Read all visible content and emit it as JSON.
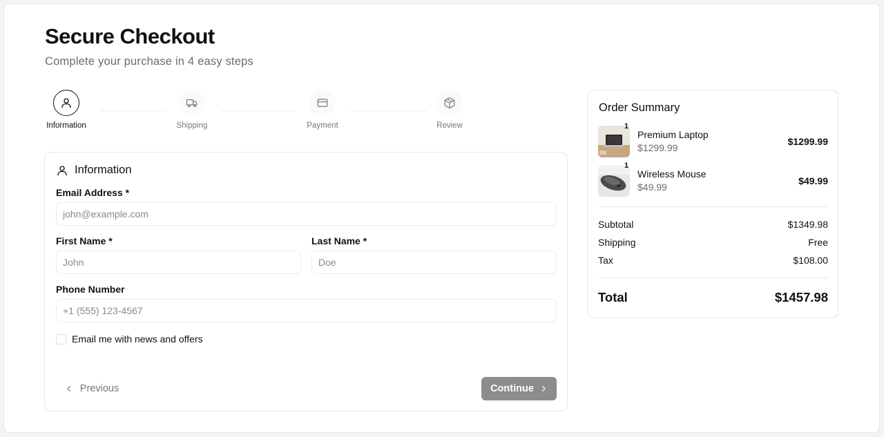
{
  "header": {
    "title": "Secure Checkout",
    "subtitle": "Complete your purchase in 4 easy steps"
  },
  "steps": [
    {
      "label": "Information",
      "icon": "user-icon",
      "active": true
    },
    {
      "label": "Shipping",
      "icon": "truck-icon",
      "active": false
    },
    {
      "label": "Payment",
      "icon": "credit-card-icon",
      "active": false
    },
    {
      "label": "Review",
      "icon": "package-icon",
      "active": false
    }
  ],
  "form": {
    "heading": "Information",
    "email": {
      "label": "Email Address *",
      "placeholder": "john@example.com",
      "value": ""
    },
    "first_name": {
      "label": "First Name *",
      "placeholder": "John",
      "value": ""
    },
    "last_name": {
      "label": "Last Name *",
      "placeholder": "Doe",
      "value": ""
    },
    "phone": {
      "label": "Phone Number",
      "placeholder": "+1 (555) 123-4567",
      "value": ""
    },
    "newsletter": {
      "label": "Email me with news and offers",
      "checked": false
    },
    "previous_label": "Previous",
    "continue_label": "Continue"
  },
  "summary": {
    "title": "Order Summary",
    "items": [
      {
        "name": "Premium Laptop",
        "qty": "1",
        "unit_price": "$1299.99",
        "total": "$1299.99",
        "image": "laptop-image"
      },
      {
        "name": "Wireless Mouse",
        "qty": "1",
        "unit_price": "$49.99",
        "total": "$49.99",
        "image": "mouse-image"
      }
    ],
    "subtotal_label": "Subtotal",
    "subtotal_value": "$1349.98",
    "shipping_label": "Shipping",
    "shipping_value": "Free",
    "tax_label": "Tax",
    "tax_value": "$108.00",
    "total_label": "Total",
    "total_value": "$1457.98"
  },
  "colors": {
    "continue_button": "#8c8c8c",
    "active_step_border": "#111111"
  }
}
